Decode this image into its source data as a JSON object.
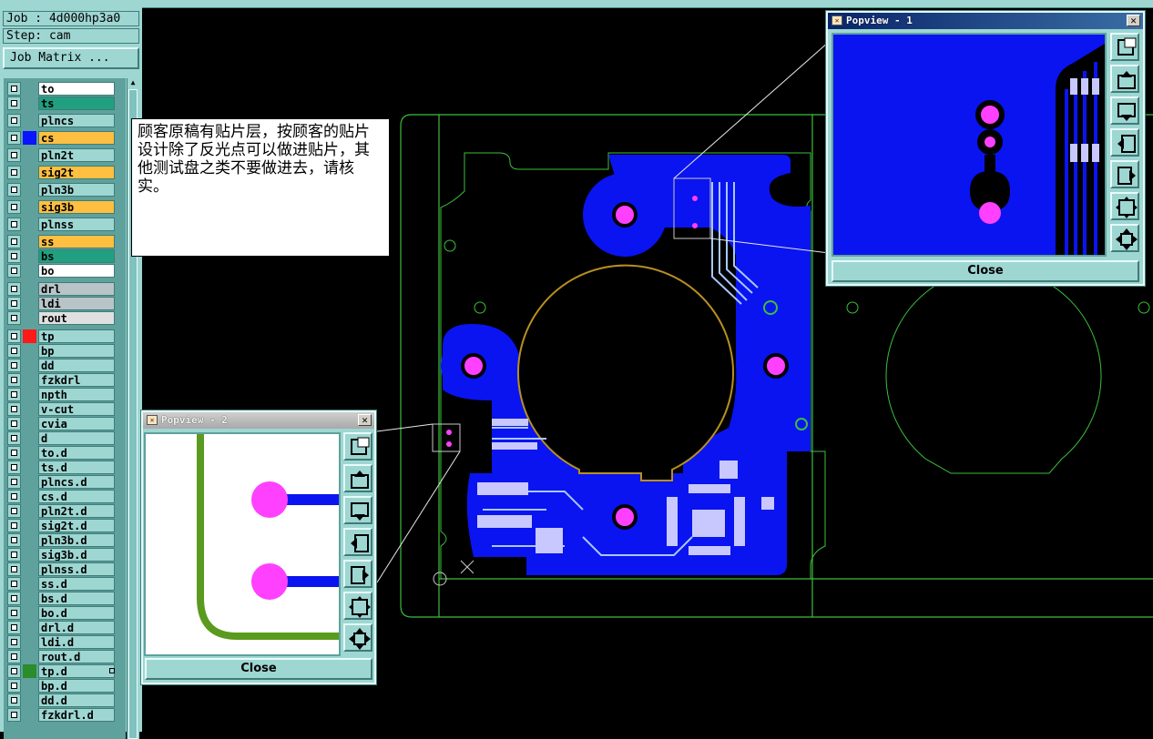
{
  "header": {
    "job": "Job : 4d000hp3a0",
    "step": "Step: cam",
    "job_matrix_button": "Job Matrix ..."
  },
  "layers": [
    {
      "name": "to",
      "color": "#ffffff",
      "swatch": ""
    },
    {
      "name": "ts",
      "color": "#20a080",
      "swatch": ""
    },
    {
      "name": "plncs",
      "color": "#9ed6d2",
      "swatch": ""
    },
    {
      "name": "cs",
      "color": "#ffbf40",
      "swatch": "#0a14ff"
    },
    {
      "name": "pln2t",
      "color": "#9ed6d2",
      "swatch": ""
    },
    {
      "name": "sig2t",
      "color": "#ffbf40",
      "swatch": ""
    },
    {
      "name": "pln3b",
      "color": "#9ed6d2",
      "swatch": ""
    },
    {
      "name": "sig3b",
      "color": "#ffbf40",
      "swatch": ""
    },
    {
      "name": "plnss",
      "color": "#9ed6d2",
      "swatch": ""
    },
    {
      "name": "ss",
      "color": "#ffbf40",
      "swatch": ""
    },
    {
      "name": "bs",
      "color": "#20a080",
      "swatch": ""
    },
    {
      "name": "bo",
      "color": "#ffffff",
      "swatch": ""
    },
    {
      "name": "drl",
      "color": "#b8c4c8",
      "swatch": ""
    },
    {
      "name": "ldi",
      "color": "#b8c4c8",
      "swatch": ""
    },
    {
      "name": "rout",
      "color": "#e0e0e0",
      "swatch": ""
    },
    {
      "name": "tp",
      "color": "#9ed6d2",
      "swatch": "#ff1a1a"
    },
    {
      "name": "bp",
      "color": "#9ed6d2",
      "swatch": ""
    },
    {
      "name": "dd",
      "color": "#9ed6d2",
      "swatch": ""
    },
    {
      "name": "fzkdrl",
      "color": "#9ed6d2",
      "swatch": ""
    },
    {
      "name": "npth",
      "color": "#9ed6d2",
      "swatch": ""
    },
    {
      "name": "v-cut",
      "color": "#9ed6d2",
      "swatch": ""
    },
    {
      "name": "cvia",
      "color": "#9ed6d2",
      "swatch": ""
    },
    {
      "name": "d",
      "color": "#9ed6d2",
      "swatch": ""
    },
    {
      "name": "to.d",
      "color": "#9ed6d2",
      "swatch": ""
    },
    {
      "name": "ts.d",
      "color": "#9ed6d2",
      "swatch": ""
    },
    {
      "name": "plncs.d",
      "color": "#9ed6d2",
      "swatch": ""
    },
    {
      "name": "cs.d",
      "color": "#9ed6d2",
      "swatch": ""
    },
    {
      "name": "pln2t.d",
      "color": "#9ed6d2",
      "swatch": ""
    },
    {
      "name": "sig2t.d",
      "color": "#9ed6d2",
      "swatch": ""
    },
    {
      "name": "pln3b.d",
      "color": "#9ed6d2",
      "swatch": ""
    },
    {
      "name": "sig3b.d",
      "color": "#9ed6d2",
      "swatch": ""
    },
    {
      "name": "plnss.d",
      "color": "#9ed6d2",
      "swatch": ""
    },
    {
      "name": "ss.d",
      "color": "#9ed6d2",
      "swatch": ""
    },
    {
      "name": "bs.d",
      "color": "#9ed6d2",
      "swatch": ""
    },
    {
      "name": "bo.d",
      "color": "#9ed6d2",
      "swatch": ""
    },
    {
      "name": "drl.d",
      "color": "#9ed6d2",
      "swatch": ""
    },
    {
      "name": "ldi.d",
      "color": "#9ed6d2",
      "swatch": ""
    },
    {
      "name": "rout.d",
      "color": "#9ed6d2",
      "swatch": ""
    },
    {
      "name": "tp.d",
      "color": "#9ed6d2",
      "swatch": "#2a8c2a",
      "marked": true
    },
    {
      "name": "bp.d",
      "color": "#9ed6d2",
      "swatch": ""
    },
    {
      "name": "dd.d",
      "color": "#9ed6d2",
      "swatch": ""
    },
    {
      "name": "fzkdrl.d",
      "color": "#9ed6d2",
      "swatch": ""
    }
  ],
  "note": {
    "text": "顾客原稿有贴片层，按顾客的贴片设计除了反光点可以做进贴片，其他测试盘之类不要做进去，请核实。"
  },
  "popview1": {
    "title": "Popview - 1",
    "close_label": "Close",
    "close_x": "✕"
  },
  "popview2": {
    "title": "Popview - 2",
    "close_label": "Close",
    "close_x": "✕"
  },
  "colors": {
    "copper": "#0a14f0",
    "pad": "#ff40ff",
    "outline": "#3cbf3c",
    "ring": "#b89020",
    "silk": "#a8c8ff"
  }
}
